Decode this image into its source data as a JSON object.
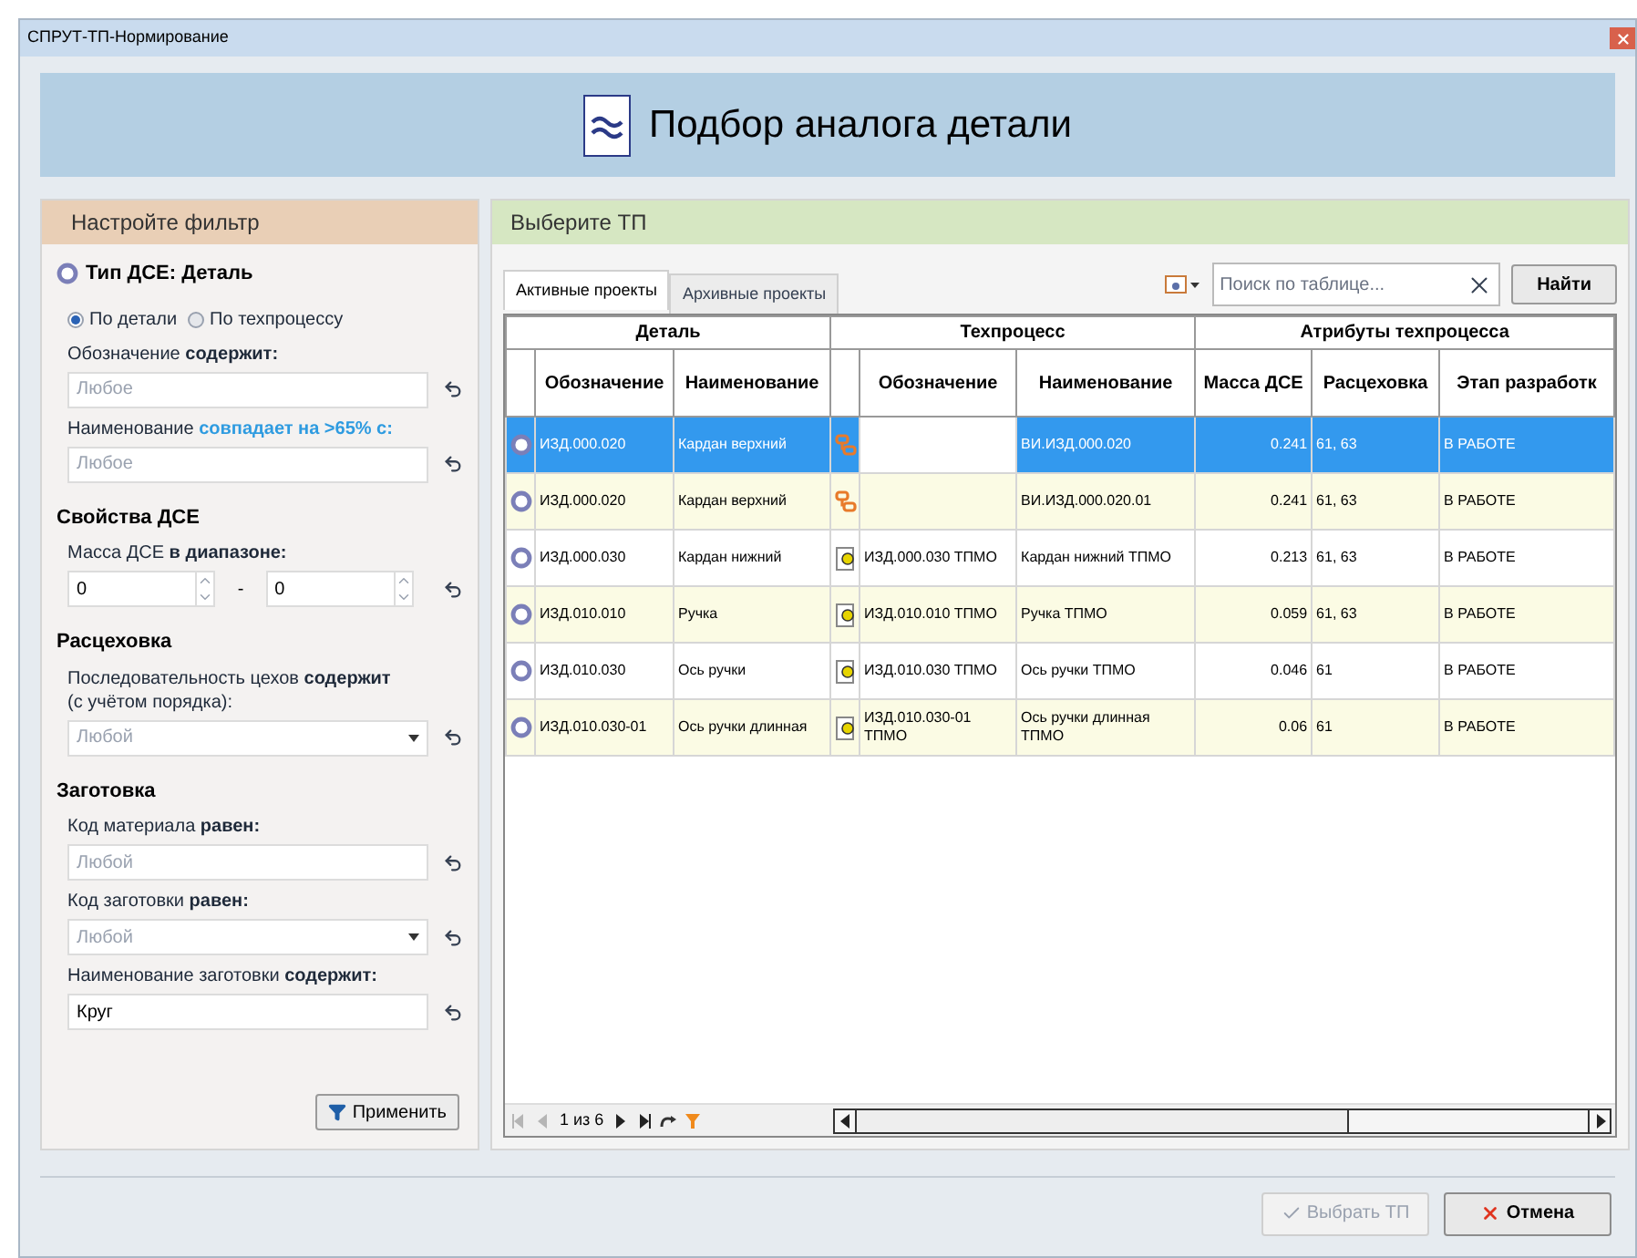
{
  "window": {
    "title": "СПРУТ-ТП-Нормирование"
  },
  "header": {
    "title": "Подбор аналога детали"
  },
  "filter": {
    "title": "Настройте фильтр",
    "dse_type": "Тип ДСЕ: Деталь",
    "modes": [
      {
        "label": "По детали",
        "selected": true
      },
      {
        "label": "По техпроцессу",
        "selected": false
      }
    ],
    "items": [
      {
        "kind": "field",
        "label": "Обозначение",
        "condition": "содержит:",
        "condition_highlight": false,
        "placeholder": "Любое"
      },
      {
        "kind": "field",
        "label": "Наименование",
        "condition": "совпадает на >65% с:",
        "condition_highlight": true,
        "placeholder": "Любое"
      },
      {
        "kind": "heading",
        "label": "Свойства ДСЕ"
      },
      {
        "kind": "range",
        "label": "Масса ДСЕ",
        "condition": "в диапазоне:",
        "condition_highlight": false,
        "from": "0",
        "separator": "-",
        "to": "0"
      },
      {
        "kind": "heading",
        "label": "Расцеховка"
      },
      {
        "kind": "dropdown",
        "label": "Последовательность цехов",
        "condition": "содержит",
        "condition_highlight": false,
        "note": "(с учётом порядка):",
        "placeholder": "Любой"
      },
      {
        "kind": "heading",
        "label": "Заготовка"
      },
      {
        "kind": "field",
        "label": "Код материала",
        "condition": "равен:",
        "condition_highlight": false,
        "placeholder": "Любой"
      },
      {
        "kind": "dropdown",
        "label": "Код заготовки",
        "condition": "равен:",
        "condition_highlight": false,
        "placeholder": "Любой"
      },
      {
        "kind": "field",
        "label": "Наименование заготовки",
        "condition": "содержит:",
        "condition_highlight": false,
        "value": "Круг"
      }
    ],
    "apply_button": "Применить"
  },
  "results": {
    "title": "Выберите ТП",
    "tabs": [
      {
        "label": "Активные проекты",
        "selected": true
      },
      {
        "label": "Архивные проекты",
        "selected": false
      }
    ],
    "search": {
      "placeholder": "Поиск по таблице..."
    },
    "search_button": "Найти",
    "column_groups": [
      "Деталь",
      "Техпроцесс",
      "Атрибуты техпроцесса"
    ],
    "columns": [
      "Обозначение",
      "Наименование",
      "Обозначение",
      "Наименование",
      "Масса ДСЕ",
      "Расцеховка",
      "Этап разработк"
    ],
    "rows": [
      {
        "selected": true,
        "kind": "link",
        "part_designation": "ИЗД.000.020",
        "part_name": "Кардан верхний",
        "tp_name": "ВИ.ИЗД.000.020",
        "mass": "0.241",
        "shops": "61, 63",
        "stage": "В РАБОТЕ"
      },
      {
        "selected": false,
        "kind": "link",
        "part_designation": "ИЗД.000.020",
        "part_name": "Кардан верхний",
        "tp_name": "ВИ.ИЗД.000.020.01",
        "mass": "0.241",
        "shops": "61, 63",
        "stage": "В РАБОТЕ"
      },
      {
        "selected": false,
        "kind": "document",
        "part_designation": "ИЗД.000.030",
        "part_name": "Кардан нижний",
        "tp_designation": "ИЗД.000.030 ТПМО",
        "tp_name": "Кардан нижний ТПМО",
        "mass": "0.213",
        "shops": "61, 63",
        "stage": "В РАБОТЕ"
      },
      {
        "selected": false,
        "kind": "document",
        "part_designation": "ИЗД.010.010",
        "part_name": "Ручка",
        "tp_designation": "ИЗД.010.010 ТПМО",
        "tp_name": "Ручка ТПМО",
        "mass": "0.059",
        "shops": "61, 63",
        "stage": "В РАБОТЕ"
      },
      {
        "selected": false,
        "kind": "document",
        "part_designation": "ИЗД.010.030",
        "part_name": "Ось ручки",
        "tp_designation": "ИЗД.010.030 ТПМО",
        "tp_name": "Ось ручки ТПМО",
        "mass": "0.046",
        "shops": "61",
        "stage": "В РАБОТЕ"
      },
      {
        "selected": false,
        "kind": "document",
        "part_designation": "ИЗД.010.030-01",
        "part_name": "Ось ручки длинная",
        "tp_designation": "ИЗД.010.030-01 ТПМО",
        "tp_name": "Ось ручки длинная ТПМО",
        "mass": "0.06",
        "shops": "61",
        "stage": "В РАБОТЕ"
      }
    ],
    "pager": "1 из 6"
  },
  "buttons": [
    {
      "label": "Выбрать ТП",
      "kind": "confirm",
      "disabled": true
    },
    {
      "label": "Отмена",
      "kind": "cancel",
      "disabled": false
    }
  ]
}
